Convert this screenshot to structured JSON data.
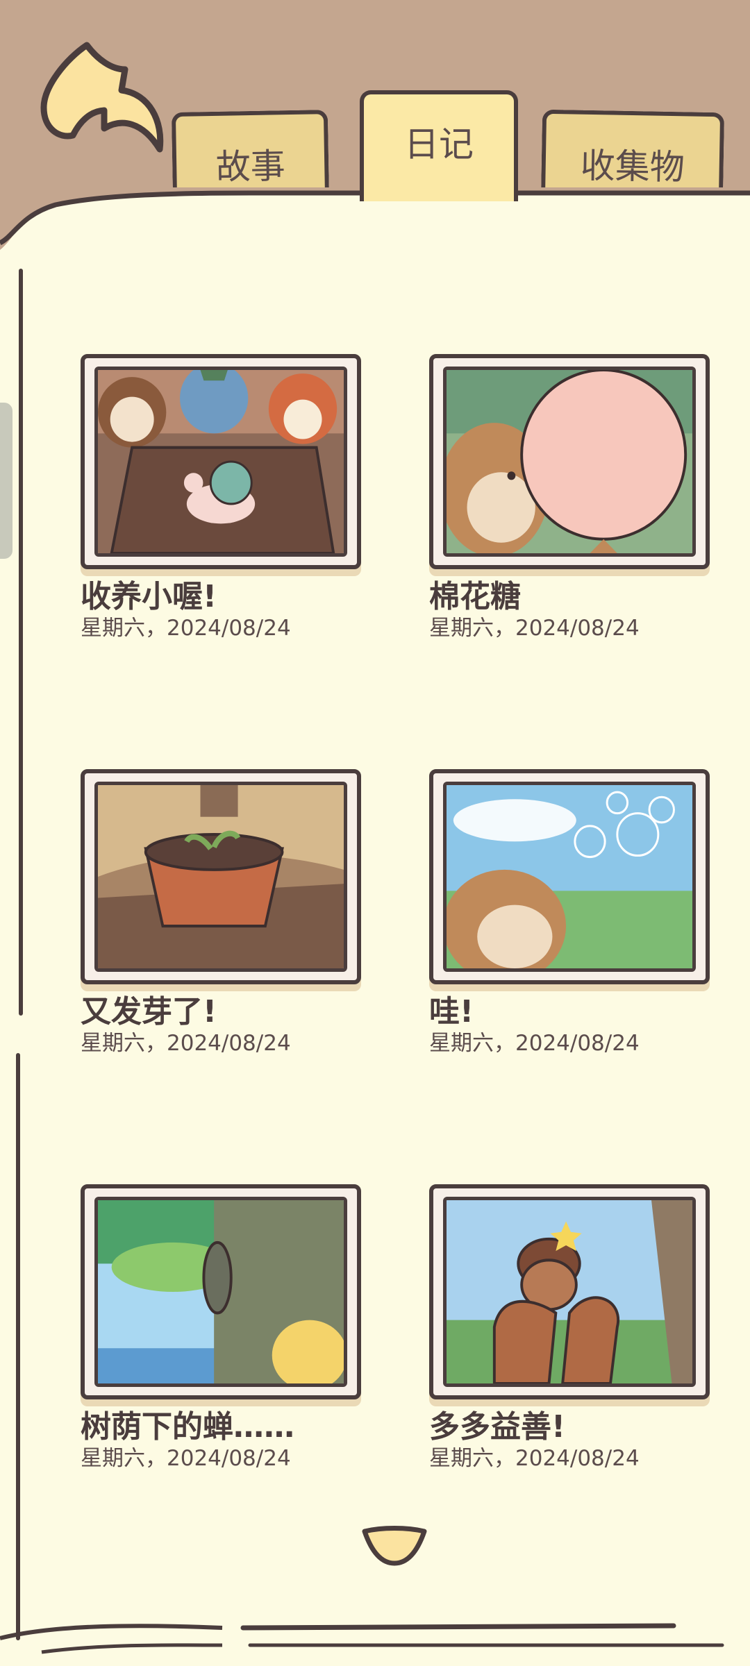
{
  "tabs": [
    {
      "label": "故事",
      "active": false
    },
    {
      "label": "日记",
      "active": true
    },
    {
      "label": "收集物",
      "active": false
    }
  ],
  "entries": [
    {
      "title": "收养小喔!",
      "date": "星期六，2024/08/24"
    },
    {
      "title": "棉花糖",
      "date": "星期六，2024/08/24"
    },
    {
      "title": "又发芽了!",
      "date": "星期六，2024/08/24"
    },
    {
      "title": "哇!",
      "date": "星期六，2024/08/24"
    },
    {
      "title": "树荫下的蝉……",
      "date": "星期六，2024/08/24"
    },
    {
      "title": "多多益善!",
      "date": "星期六，2024/08/24"
    }
  ],
  "colors": {
    "background": "#c4a68f",
    "paper": "#fdfbe3",
    "tab": "#ebd491",
    "tab_active": "#fbe9a6",
    "outline": "#4a3d3d"
  },
  "icons": {
    "back": "back-arrow-icon",
    "scroll_down": "chevron-down-icon"
  }
}
